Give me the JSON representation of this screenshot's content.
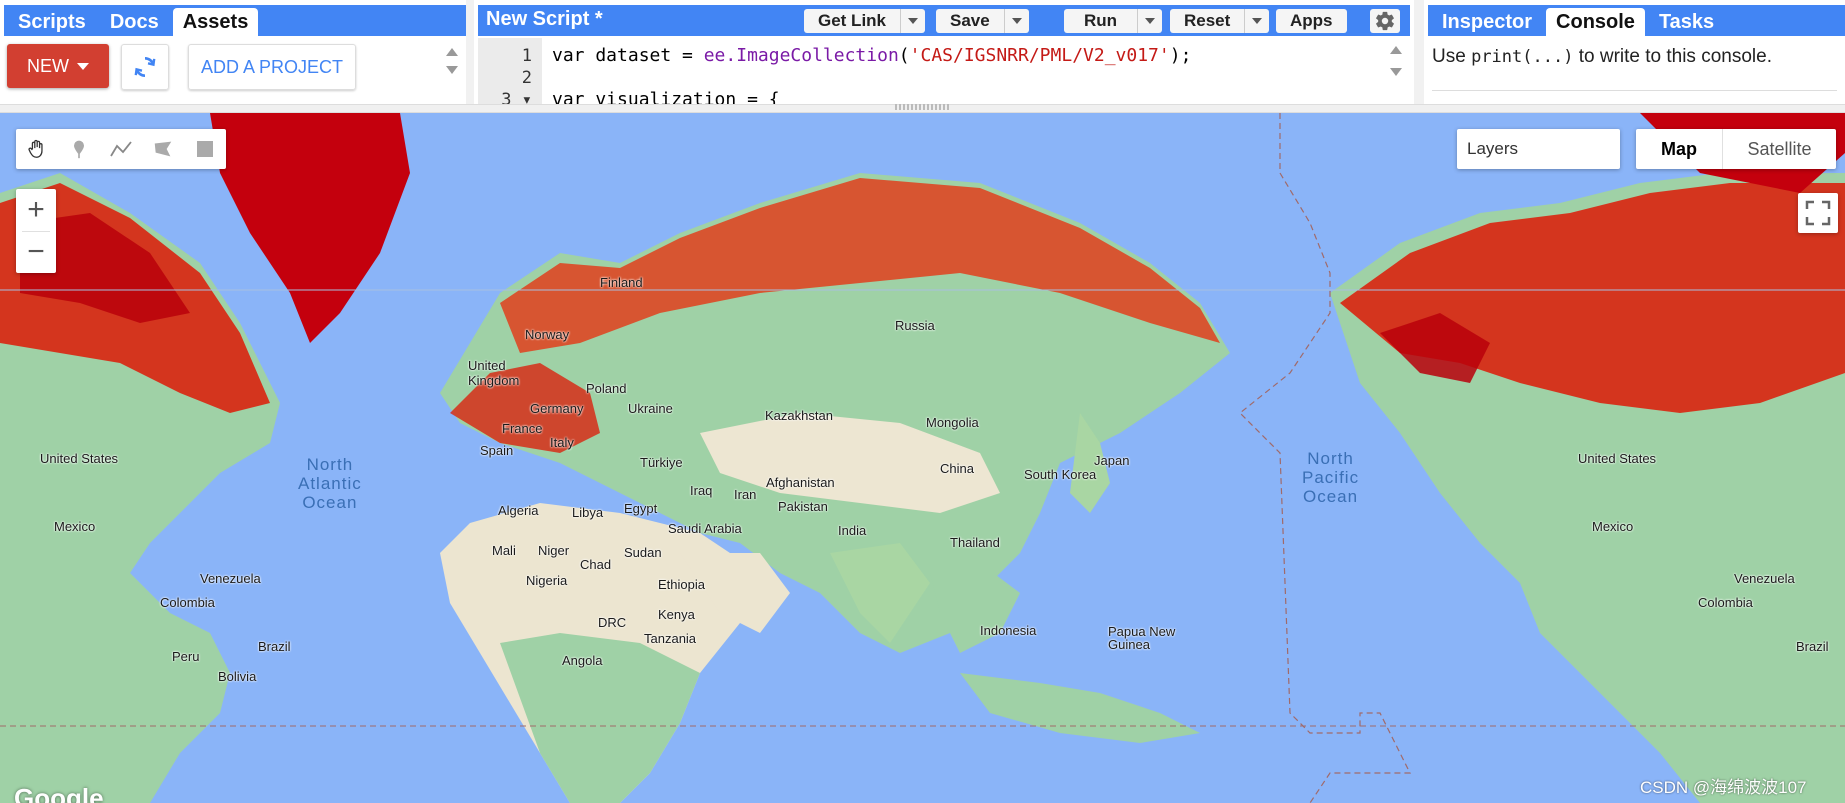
{
  "left_panel": {
    "tabs": [
      {
        "label": "Scripts",
        "active": false
      },
      {
        "label": "Docs",
        "active": false
      },
      {
        "label": "Assets",
        "active": true
      }
    ],
    "new_button": "NEW",
    "add_project_button": "ADD A PROJECT",
    "icons": {
      "refresh": "refresh-icon",
      "dropdown": "caret-down-icon"
    }
  },
  "editor": {
    "script_title": "New Script *",
    "toolbar": {
      "get_link": "Get Link",
      "save": "Save",
      "run": "Run",
      "reset": "Reset",
      "apps": "Apps"
    },
    "lines": [
      {
        "number": "1",
        "text_plain": "var dataset = ",
        "fn": "ee.ImageCollection",
        "paren_open": "(",
        "string": "'CAS/IGSNRR/PML/V2_v017'",
        "tail": ");"
      },
      {
        "number": "2",
        "text": ""
      },
      {
        "number": "3 ▾",
        "text": "var visualization = {"
      }
    ]
  },
  "right_panel": {
    "tabs": [
      {
        "label": "Inspector",
        "active": false
      },
      {
        "label": "Console",
        "active": true
      },
      {
        "label": "Tasks",
        "active": false
      }
    ],
    "console_prefix": "Use",
    "console_code": "print(...)",
    "console_suffix": "to write to this console."
  },
  "map": {
    "layers_label": "Layers",
    "map_type_active": "Map",
    "map_type_other": "Satellite",
    "zoom_in": "+",
    "zoom_out": "−",
    "google_logo": "Google",
    "watermark": "CSDN @海绵波波107",
    "oceans": [
      {
        "name": "North\nAtlantic\nOcean"
      },
      {
        "name": "North\nPacific\nOcean"
      }
    ],
    "labels": [
      "Finland",
      "Norway",
      "United Kingdom",
      "Poland",
      "Germany",
      "Ukraine",
      "France",
      "Italy",
      "Spain",
      "Russia",
      "Kazakhstan",
      "Mongolia",
      "Türkiye",
      "Iraq",
      "Iran",
      "Afghanistan",
      "Pakistan",
      "China",
      "South Korea",
      "Japan",
      "India",
      "Thailand",
      "Algeria",
      "Libya",
      "Egypt",
      "Saudi Arabia",
      "Mali",
      "Niger",
      "Chad",
      "Sudan",
      "Nigeria",
      "Ethiopia",
      "Kenya",
      "DRC",
      "Tanzania",
      "Angola",
      "Indonesia",
      "Papua New Guinea",
      "United States",
      "United States",
      "Mexico",
      "Mexico",
      "Venezuela",
      "Venezuela",
      "Colombia",
      "Colombia",
      "Peru",
      "Brazil",
      "Brazil",
      "Bolivia"
    ],
    "colors": {
      "ocean": "#8ab4f8",
      "land_low": "#9fd1a6",
      "land_mid": "#e8e0c8",
      "high_et": "#d9230f",
      "very_high": "#b8000b"
    }
  }
}
